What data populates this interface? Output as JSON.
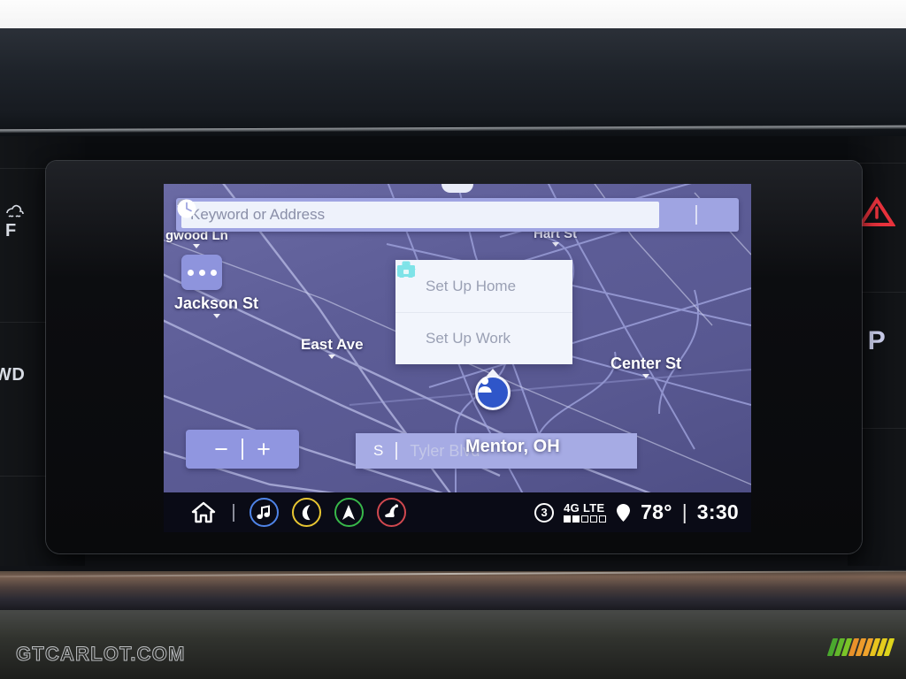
{
  "vehicle_ui": {
    "screen_name": "navigation-map-screen",
    "search": {
      "placeholder": "Keyword or Address",
      "value": "",
      "search_icon": "magnifier-icon",
      "favorites_icon": "star-icon",
      "recents_icon": "clock-icon"
    },
    "map": {
      "menu_button_icon": "ellipsis-icon",
      "street_labels": [
        {
          "name": "gwood Ln",
          "full": "Dogwood Ln"
        },
        {
          "name": "Jackson St"
        },
        {
          "name": "East Ave"
        },
        {
          "name": "Hart St"
        },
        {
          "name": "St"
        },
        {
          "name": "Center St"
        }
      ],
      "vehicle_marker_icon": "person-avatar-icon",
      "zoom_out_label": "−",
      "zoom_in_label": "+",
      "current_road_prefix": "S",
      "current_road": "Tyler Blvd",
      "current_city": "Mentor, OH"
    },
    "setup_panel": {
      "rows": [
        {
          "label": "Set Up Home",
          "icon": "home-icon"
        },
        {
          "label": "Set Up Work",
          "icon": "briefcase-icon"
        }
      ]
    },
    "bottom_nav": [
      {
        "name": "home",
        "icon": "home-icon",
        "color": "#ffffff",
        "ringed": false
      },
      {
        "name": "media",
        "icon": "music-note-icon",
        "color": "#4f84e8",
        "ringed": true
      },
      {
        "name": "phone",
        "icon": "phone-icon",
        "color": "#e8c632",
        "ringed": true
      },
      {
        "name": "navigation",
        "icon": "navigation-arrow-icon",
        "color": "#38b84a",
        "ringed": true
      },
      {
        "name": "comfort",
        "icon": "seat-icon",
        "color": "#d0484f",
        "ringed": true
      }
    ],
    "status_bar": {
      "sim_label": "3",
      "network_label": "4G LTE",
      "signal_bars_total": 5,
      "signal_bars_filled": 2,
      "location_icon": "map-pin-icon",
      "temperature": "78°",
      "separator": "|",
      "time": "3:30"
    }
  },
  "dashboard": {
    "left_switches": [
      {
        "label": "F",
        "icon": "defrost-icon"
      },
      {
        "label": "WD",
        "icon": "awd-icon"
      }
    ],
    "right_switches": [
      {
        "label": "",
        "icon": "hazard-triangle-icon"
      },
      {
        "label": "P",
        "icon": "park-brake-icon"
      }
    ]
  },
  "watermark": {
    "text": "GTCARLOT.COM",
    "logo_colors": [
      "#4aa82e",
      "#7bc428",
      "#e8912a",
      "#f0a32c",
      "#e8c41e",
      "#ddd41c"
    ]
  }
}
